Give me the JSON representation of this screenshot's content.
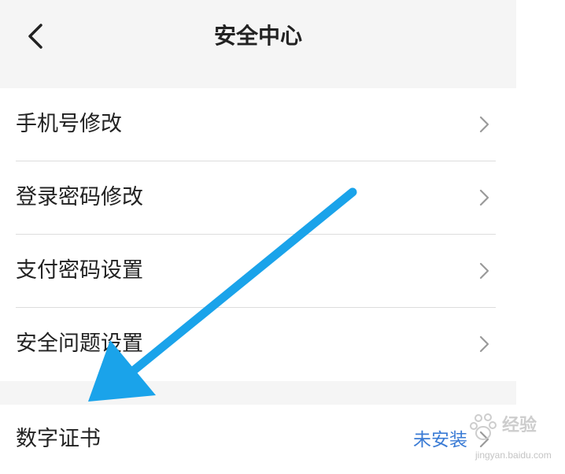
{
  "header": {
    "title": "安全中心",
    "back_icon": "chevron-left-icon"
  },
  "menu": {
    "items": [
      {
        "label": "手机号修改"
      },
      {
        "label": "登录密码修改"
      },
      {
        "label": "支付密码设置"
      },
      {
        "label": "安全问题设置"
      }
    ]
  },
  "certificate": {
    "label": "数字证书",
    "status": "未安装"
  },
  "watermark": {
    "brand": "经验",
    "url": "jingyan.baidu.com"
  },
  "colors": {
    "arrow": "#1aa3ea",
    "status": "#3a7bd5",
    "background": "#f5f5f5"
  }
}
